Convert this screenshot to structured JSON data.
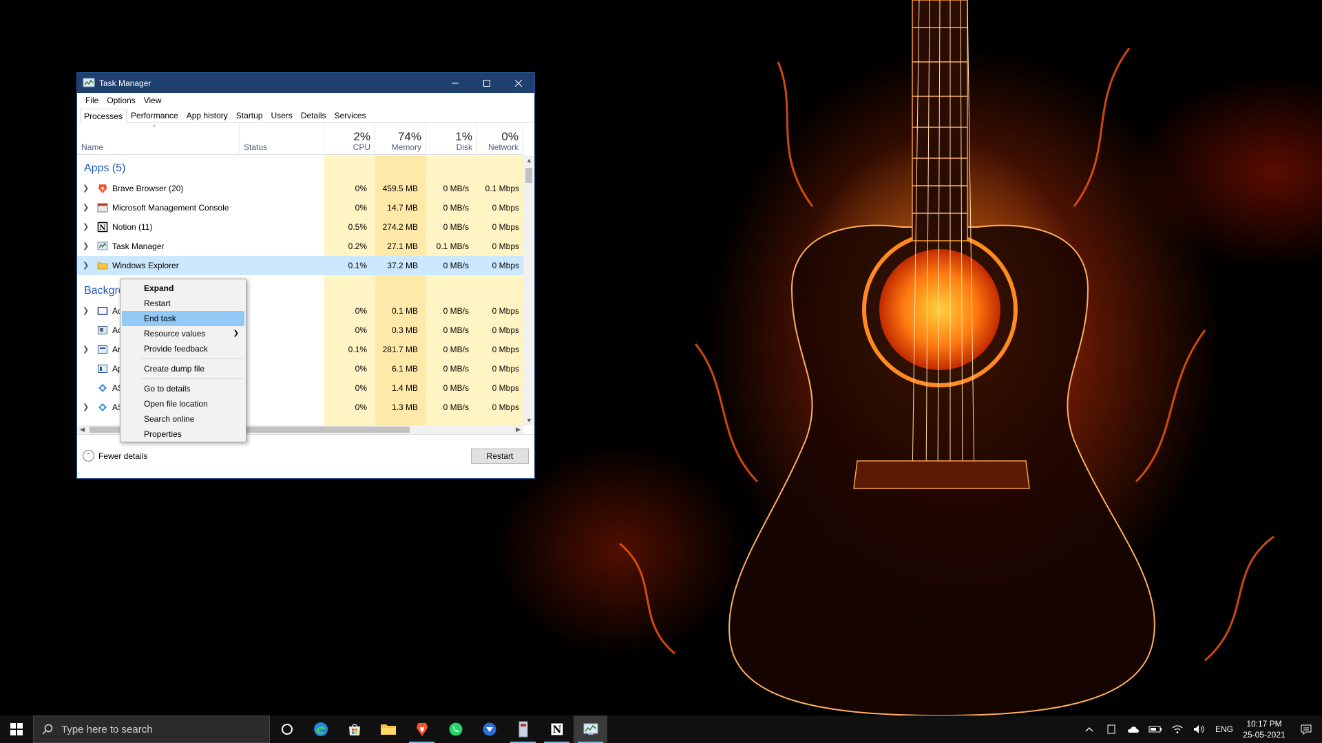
{
  "window": {
    "title": "Task Manager",
    "menu": [
      "File",
      "Options",
      "View"
    ],
    "tabs": [
      "Processes",
      "Performance",
      "App history",
      "Startup",
      "Users",
      "Details",
      "Services"
    ],
    "active_tab": "Processes"
  },
  "columns": {
    "name": "Name",
    "status": "Status",
    "cpu": {
      "pct": "2%",
      "label": "CPU"
    },
    "memory": {
      "pct": "74%",
      "label": "Memory"
    },
    "disk": {
      "pct": "1%",
      "label": "Disk"
    },
    "network": {
      "pct": "0%",
      "label": "Network"
    }
  },
  "groups": {
    "apps": "Apps (5)",
    "background": "Backgro"
  },
  "apps": [
    {
      "name": "Brave Browser (20)",
      "cpu": "0%",
      "memory": "459.5 MB",
      "disk": "0 MB/s",
      "network": "0.1 Mbps",
      "icon": "brave-icon"
    },
    {
      "name": "Microsoft Management Console",
      "cpu": "0%",
      "memory": "14.7 MB",
      "disk": "0 MB/s",
      "network": "0 Mbps",
      "icon": "mmc-icon"
    },
    {
      "name": "Notion (11)",
      "cpu": "0.5%",
      "memory": "274.2 MB",
      "disk": "0 MB/s",
      "network": "0 Mbps",
      "icon": "notion-icon"
    },
    {
      "name": "Task Manager",
      "cpu": "0.2%",
      "memory": "27.1 MB",
      "disk": "0.1 MB/s",
      "network": "0 Mbps",
      "icon": "task-manager-icon"
    },
    {
      "name": "Windows Explorer",
      "cpu": "0.1%",
      "memory": "37.2 MB",
      "disk": "0 MB/s",
      "network": "0 Mbps",
      "icon": "folder-icon"
    }
  ],
  "background": [
    {
      "name": "Ac",
      "cpu": "0%",
      "memory": "0.1 MB",
      "disk": "0 MB/s",
      "network": "0 Mbps"
    },
    {
      "name": "Ac",
      "cpu": "0%",
      "memory": "0.3 MB",
      "disk": "0 MB/s",
      "network": "0 Mbps"
    },
    {
      "name": "Ar",
      "cpu": "0.1%",
      "memory": "281.7 MB",
      "disk": "0 MB/s",
      "network": "0 Mbps"
    },
    {
      "name": "Ap",
      "cpu": "0%",
      "memory": "6.1 MB",
      "disk": "0 MB/s",
      "network": "0 Mbps"
    },
    {
      "name": "AS",
      "cpu": "0%",
      "memory": "1.4 MB",
      "disk": "0 MB/s",
      "network": "0 Mbps"
    },
    {
      "name": "AS",
      "cpu": "0%",
      "memory": "1.3 MB",
      "disk": "0 MB/s",
      "network": "0 Mbps"
    }
  ],
  "footer": {
    "fewer_details": "Fewer details",
    "restart": "Restart"
  },
  "context_menu": {
    "expand": "Expand",
    "restart": "Restart",
    "end_task": "End task",
    "resource_values": "Resource values",
    "provide_feedback": "Provide feedback",
    "create_dump": "Create dump file",
    "go_to_details": "Go to details",
    "open_file_location": "Open file location",
    "search_online": "Search online",
    "properties": "Properties"
  },
  "taskbar": {
    "search_placeholder": "Type here to search",
    "language": "ENG",
    "time": "10:17 PM",
    "date": "25-05-2021"
  },
  "colors": {
    "titlebar": "#1f3f6e",
    "heat_light": "#fff4c4",
    "heat_medium": "#ffe9a8",
    "selection": "#cce8ff",
    "menu_hot": "#91c9f7",
    "link_blue": "#1f57b8"
  }
}
